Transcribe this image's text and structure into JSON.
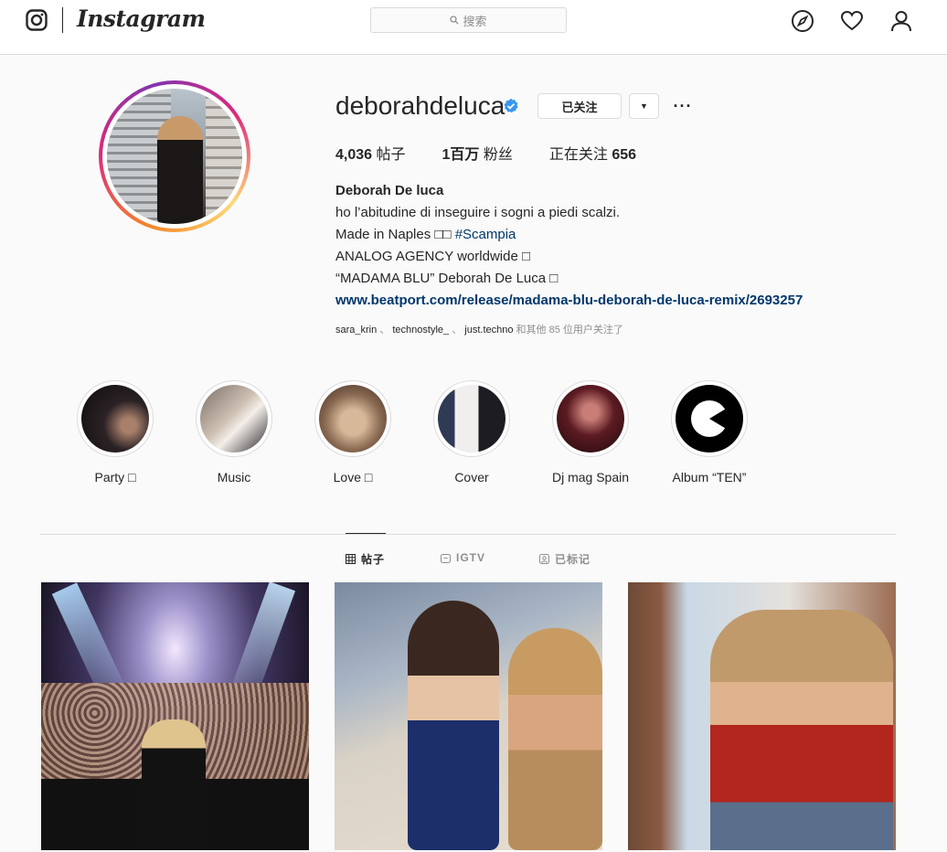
{
  "nav": {
    "wordmark": "Instagram",
    "search_placeholder": "搜索"
  },
  "profile": {
    "username": "deborahdeluca",
    "verified": true,
    "follow_button": "已关注",
    "dropdown_glyph": "▼",
    "more_glyph": "···",
    "stats": {
      "posts_value": "4,036",
      "posts_label": " 帖子",
      "followers_value": "1百万",
      "followers_label": " 粉丝",
      "following_label": "正在关注 ",
      "following_value": "656"
    },
    "bio": {
      "name": "Deborah De luca",
      "line1": "ho l’abitudine di inseguire i sogni a piedi scalzi.",
      "line2_text": "Made in Naples □□ ",
      "line2_tag": "#Scampia",
      "line3": "ANALOG AGENCY worldwide □",
      "line4": "“MADAMA BLU” Deborah De Luca □",
      "link": "www.beatport.com/release/madama-blu-deborah-de-luca-remix/2693257"
    },
    "followed_by": {
      "users": [
        "sara_krin",
        "technostyle_",
        "just.techno"
      ],
      "sep1": " 、 ",
      "sep2": " 、 ",
      "rest": " 和其他 85 位用户关注了"
    }
  },
  "highlights": [
    {
      "label": "Party □"
    },
    {
      "label": "Music"
    },
    {
      "label": "Love □"
    },
    {
      "label": "Cover"
    },
    {
      "label": "Dj mag Spain"
    },
    {
      "label": "Album “TEN”"
    }
  ],
  "tabs": {
    "posts": "帖子",
    "igtv": "IGTV",
    "tagged": "已标记"
  },
  "colors": {
    "link": "#00376b",
    "verified": "#3897f0",
    "border": "#dbdbdb",
    "muted": "#8e8e8e"
  }
}
